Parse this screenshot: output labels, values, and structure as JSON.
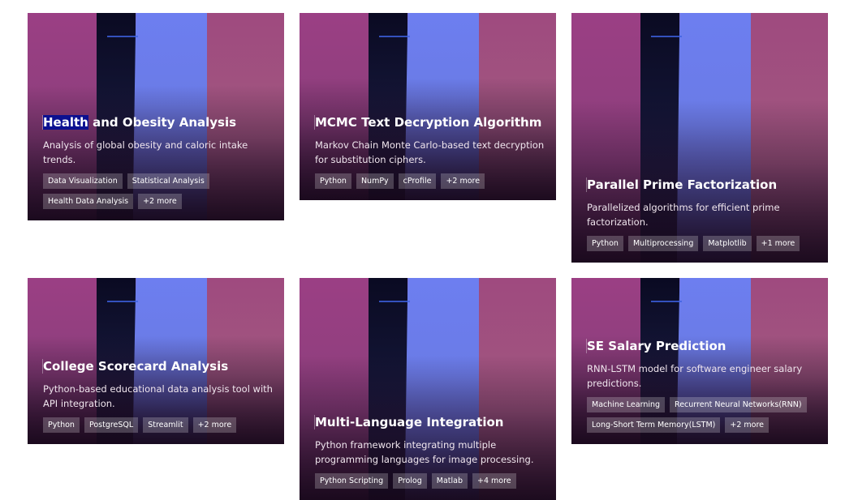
{
  "cards": [
    {
      "title_highlight": "Health",
      "title_rest": " and Obesity Analysis",
      "description": "Analysis of global obesity and caloric intake trends.",
      "tags": [
        "Data Visualization",
        "Statistical Analysis",
        "Health Data Analysis",
        "+2 more"
      ]
    },
    {
      "title": "MCMC Text Decryption Algorithm",
      "description": "Markov Chain Monte Carlo-based text decryption for substitution ciphers.",
      "tags": [
        "Python",
        "NumPy",
        "cProfile",
        "+2 more"
      ]
    },
    {
      "title": "Parallel Prime Factorization",
      "description": "Parallelized algorithms for efficient prime factorization.",
      "tags": [
        "Python",
        "Multiprocessing",
        "Matplotlib",
        "+1 more"
      ]
    },
    {
      "title": "College Scorecard Analysis",
      "description": "Python-based educational data analysis tool with API integration.",
      "tags": [
        "Python",
        "PostgreSQL",
        "Streamlit",
        "+2 more"
      ]
    },
    {
      "title": "Multi-Language Integration",
      "description": "Python framework integrating multiple programming languages for image processing.",
      "tags": [
        "Python Scripting",
        "Prolog",
        "Matlab",
        "+4 more"
      ]
    },
    {
      "title": "SE Salary Prediction",
      "description": "RNN-LSTM model for software engineer salary predictions.",
      "tags": [
        "Machine Learning",
        "Recurrent Neural Networks(RNN)",
        "Long-Short Term Memory(LSTM)",
        "+2 more"
      ]
    }
  ]
}
